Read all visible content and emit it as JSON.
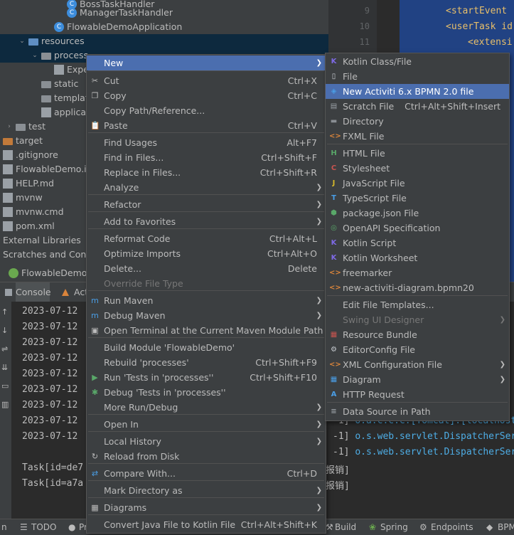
{
  "project_tree": {
    "rows": [
      {
        "label": "BossTaskHandler",
        "icon": "class-icon"
      },
      {
        "label": "ManagerTaskHandler",
        "icon": "class-icon"
      },
      {
        "label": "FlowableDemoApplication",
        "icon": "class-icon"
      },
      {
        "label": "resources",
        "icon": "folder-icon"
      },
      {
        "label": "process",
        "icon": "folder-icon"
      },
      {
        "label": "Expe",
        "icon": "file-icon"
      },
      {
        "label": "static",
        "icon": "folder-icon"
      },
      {
        "label": "templat",
        "icon": "folder-icon"
      },
      {
        "label": "applicat",
        "icon": "file-icon"
      },
      {
        "label": "test",
        "icon": "folder-icon"
      },
      {
        "label": "target",
        "icon": "folder-icon"
      },
      {
        "label": ".gitignore",
        "icon": "file-icon"
      },
      {
        "label": "FlowableDemo.im",
        "icon": "file-icon"
      },
      {
        "label": "HELP.md",
        "icon": "file-icon"
      },
      {
        "label": "mvnw",
        "icon": "file-icon"
      },
      {
        "label": "mvnw.cmd",
        "icon": "file-icon"
      },
      {
        "label": "pom.xml",
        "icon": "file-icon"
      },
      {
        "label": "External Libraries",
        "icon": "library-icon"
      },
      {
        "label": "Scratches and Conso",
        "icon": "scratch-icon"
      }
    ],
    "run_config": "FlowableDemoA"
  },
  "editor": {
    "line_numbers": [
      "9",
      "10",
      "11"
    ],
    "code_lines": [
      "<startEvent",
      "<userTask id",
      "<extensi"
    ]
  },
  "console": {
    "tabs": [
      "Console",
      "Act"
    ],
    "timestamps": [
      "2023-07-12",
      "2023-07-12",
      "2023-07-12",
      "2023-07-12",
      "2023-07-12",
      "2023-07-12",
      "2023-07-12",
      "2023-07-12",
      "2023-07-12"
    ],
    "tasks": [
      "Task[id=de7",
      "Task[id=a7a"
    ],
    "right_tail": [
      {
        "prefix": "-1]",
        "text": "o.a.c.c.C.[Tomcat].[localhost"
      },
      {
        "prefix": "-1]",
        "text": "o.s.web.servlet.DispatcherSer"
      },
      {
        "prefix": "-1]",
        "text": "o.s.web.servlet.DispatcherSer"
      },
      {
        "prefix": "",
        "text": "报销]"
      },
      {
        "prefix": "",
        "text": "报销]"
      }
    ]
  },
  "statusbar": {
    "items": [
      "n",
      "TODO",
      "Pr",
      "Build",
      "Spring",
      "Endpoints",
      "BPM"
    ]
  },
  "context_menu": {
    "items": [
      {
        "label": "New",
        "shortcut": "",
        "submenu": true
      },
      {
        "label": "Cut",
        "shortcut": "Ctrl+X",
        "icon": "scissors-icon"
      },
      {
        "label": "Copy",
        "shortcut": "Ctrl+C",
        "icon": "copy-icon"
      },
      {
        "label": "Copy Path/Reference...",
        "shortcut": ""
      },
      {
        "label": "Paste",
        "shortcut": "Ctrl+V",
        "icon": "paste-icon"
      },
      {
        "label": "Find Usages",
        "shortcut": "Alt+F7"
      },
      {
        "label": "Find in Files...",
        "shortcut": "Ctrl+Shift+F"
      },
      {
        "label": "Replace in Files...",
        "shortcut": "Ctrl+Shift+R"
      },
      {
        "label": "Analyze",
        "shortcut": "",
        "submenu": true
      },
      {
        "label": "Refactor",
        "shortcut": "",
        "submenu": true
      },
      {
        "label": "Add to Favorites",
        "shortcut": "",
        "submenu": true
      },
      {
        "label": "Reformat Code",
        "shortcut": "Ctrl+Alt+L"
      },
      {
        "label": "Optimize Imports",
        "shortcut": "Ctrl+Alt+O"
      },
      {
        "label": "Delete...",
        "shortcut": "Delete"
      },
      {
        "label": "Override File Type",
        "shortcut": "",
        "disabled": true
      },
      {
        "label": "Run Maven",
        "shortcut": "",
        "submenu": true,
        "icon": "maven-icon"
      },
      {
        "label": "Debug Maven",
        "shortcut": "",
        "submenu": true,
        "icon": "maven-icon"
      },
      {
        "label": "Open Terminal at the Current Maven Module Path",
        "shortcut": "",
        "icon": "terminal-icon"
      },
      {
        "label": "Build Module 'FlowableDemo'",
        "shortcut": ""
      },
      {
        "label": "Rebuild 'processes'",
        "shortcut": "Ctrl+Shift+F9"
      },
      {
        "label": "Run 'Tests in 'processes''",
        "shortcut": "Ctrl+Shift+F10",
        "icon": "run-icon"
      },
      {
        "label": "Debug 'Tests in 'processes''",
        "shortcut": "",
        "icon": "debug-icon"
      },
      {
        "label": "More Run/Debug",
        "shortcut": "",
        "submenu": true
      },
      {
        "label": "Open In",
        "shortcut": "",
        "submenu": true
      },
      {
        "label": "Local History",
        "shortcut": "",
        "submenu": true
      },
      {
        "label": "Reload from Disk",
        "shortcut": "",
        "icon": "reload-icon"
      },
      {
        "label": "Compare With...",
        "shortcut": "Ctrl+D",
        "icon": "compare-icon"
      },
      {
        "label": "Mark Directory as",
        "shortcut": "",
        "submenu": true
      },
      {
        "label": "Diagrams",
        "shortcut": "",
        "submenu": true,
        "icon": "diagram-icon"
      },
      {
        "label": "Convert Java File to Kotlin File",
        "shortcut": "Ctrl+Alt+Shift+K"
      }
    ]
  },
  "new_submenu": {
    "items": [
      {
        "label": "Kotlin Class/File",
        "shortcut": "",
        "icon": "kotlin-icon"
      },
      {
        "label": "File",
        "shortcut": "",
        "icon": "file-icon"
      },
      {
        "label": "New Activiti 6.x BPMN 2.0 file",
        "shortcut": "",
        "icon": "activiti-icon"
      },
      {
        "label": "Scratch File",
        "shortcut": "Ctrl+Alt+Shift+Insert",
        "icon": "scratch-icon"
      },
      {
        "label": "Directory",
        "shortcut": "",
        "icon": "folder-icon"
      },
      {
        "label": "FXML File",
        "shortcut": "",
        "icon": "fxml-icon"
      },
      {
        "label": "HTML File",
        "shortcut": "",
        "icon": "html-icon"
      },
      {
        "label": "Stylesheet",
        "shortcut": "",
        "icon": "css-icon"
      },
      {
        "label": "JavaScript File",
        "shortcut": "",
        "icon": "js-icon"
      },
      {
        "label": "TypeScript File",
        "shortcut": "",
        "icon": "ts-icon"
      },
      {
        "label": "package.json File",
        "shortcut": "",
        "icon": "nodejs-icon"
      },
      {
        "label": "OpenAPI Specification",
        "shortcut": "",
        "icon": "openapi-icon"
      },
      {
        "label": "Kotlin Script",
        "shortcut": "",
        "icon": "kotlin-icon"
      },
      {
        "label": "Kotlin Worksheet",
        "shortcut": "",
        "icon": "kotlin-icon"
      },
      {
        "label": "freemarker",
        "shortcut": "",
        "icon": "template-icon"
      },
      {
        "label": "new-activiti-diagram.bpmn20",
        "shortcut": "",
        "icon": "template-icon"
      },
      {
        "label": "Edit File Templates...",
        "shortcut": ""
      },
      {
        "label": "Swing UI Designer",
        "shortcut": "",
        "submenu": true,
        "disabled": true
      },
      {
        "label": "Resource Bundle",
        "shortcut": "",
        "icon": "bundle-icon"
      },
      {
        "label": "EditorConfig File",
        "shortcut": "",
        "icon": "gear-icon"
      },
      {
        "label": "XML Configuration File",
        "shortcut": "",
        "submenu": true,
        "icon": "xml-icon"
      },
      {
        "label": "Diagram",
        "shortcut": "",
        "submenu": true,
        "icon": "diagram-icon"
      },
      {
        "label": "HTTP Request",
        "shortcut": "",
        "icon": "api-icon"
      },
      {
        "label": "Data Source in Path",
        "shortcut": "",
        "icon": "database-icon"
      }
    ]
  }
}
